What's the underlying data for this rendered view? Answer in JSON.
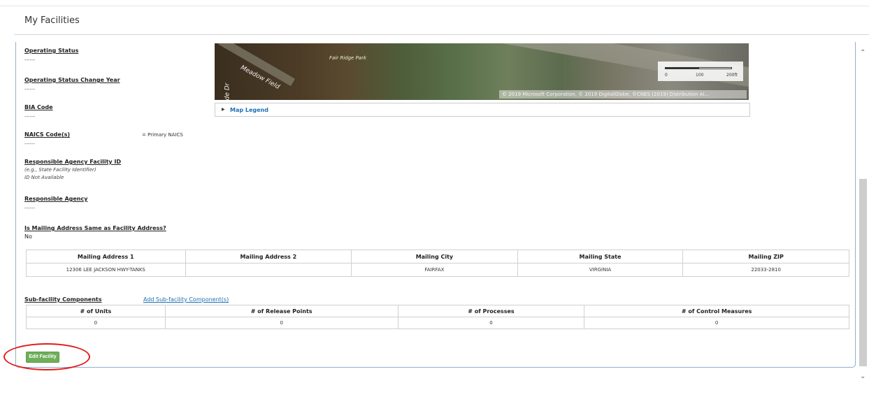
{
  "page": {
    "title": "My Facilities"
  },
  "fields": {
    "operating_status": {
      "label": "Operating Status",
      "value": "------"
    },
    "operating_status_year": {
      "label": "Operating Status Change Year",
      "value": "------"
    },
    "bia_code": {
      "label": "BIA Code",
      "value": "------"
    },
    "naics": {
      "label": "NAICS Code(s)",
      "note": "= Primary NAICS",
      "value": "------"
    },
    "agency_facility_id": {
      "label": "Responsible Agency Facility ID",
      "hint": "(e.g., State Facility Identifier)",
      "value": "ID Not Available"
    },
    "responsible_agency": {
      "label": "Responsible Agency",
      "value": "------"
    },
    "mailing_same": {
      "label": "Is Mailing Address Same as Facility Address?",
      "value": "No"
    }
  },
  "map": {
    "labels": {
      "park": "Fair Ridge Park",
      "street": "Meadow Field",
      "road": "de Dr"
    },
    "scale": {
      "t0": "0",
      "t1": "100",
      "t2": "200ft"
    },
    "attribution": "© 2019 Microsoft Corporation, © 2019 DigitalGlobe, ©CNES (2019) Distribution Ai...",
    "legend_label": "Map Legend"
  },
  "mailing_table": {
    "headers": [
      "Mailing Address 1",
      "Mailing Address 2",
      "Mailing City",
      "Mailing State",
      "Mailing ZIP"
    ],
    "row": [
      "12306 LEE JACKSON HWY-TANKS",
      "",
      "FAIRFAX",
      "VIRGINIA",
      "22033-2810"
    ]
  },
  "subfacility": {
    "title": "Sub-facility Components",
    "add_link": "Add Sub-facility Component(s)",
    "headers": [
      "# of Units",
      "# of Release Points",
      "# of Processes",
      "# of Control Measures"
    ],
    "row": [
      "0",
      "0",
      "0",
      "0"
    ]
  },
  "actions": {
    "edit_label": "Edit Facility"
  },
  "colors": {
    "accent": "#1f6fb5",
    "edit_button": "#6fae5a",
    "highlight": "#e31b1b",
    "panel_border": "#8fb0cc"
  },
  "icons": {
    "scroll_up": "chevron-up-icon",
    "scroll_down": "chevron-down-icon",
    "legend_caret": "caret-right-icon"
  }
}
